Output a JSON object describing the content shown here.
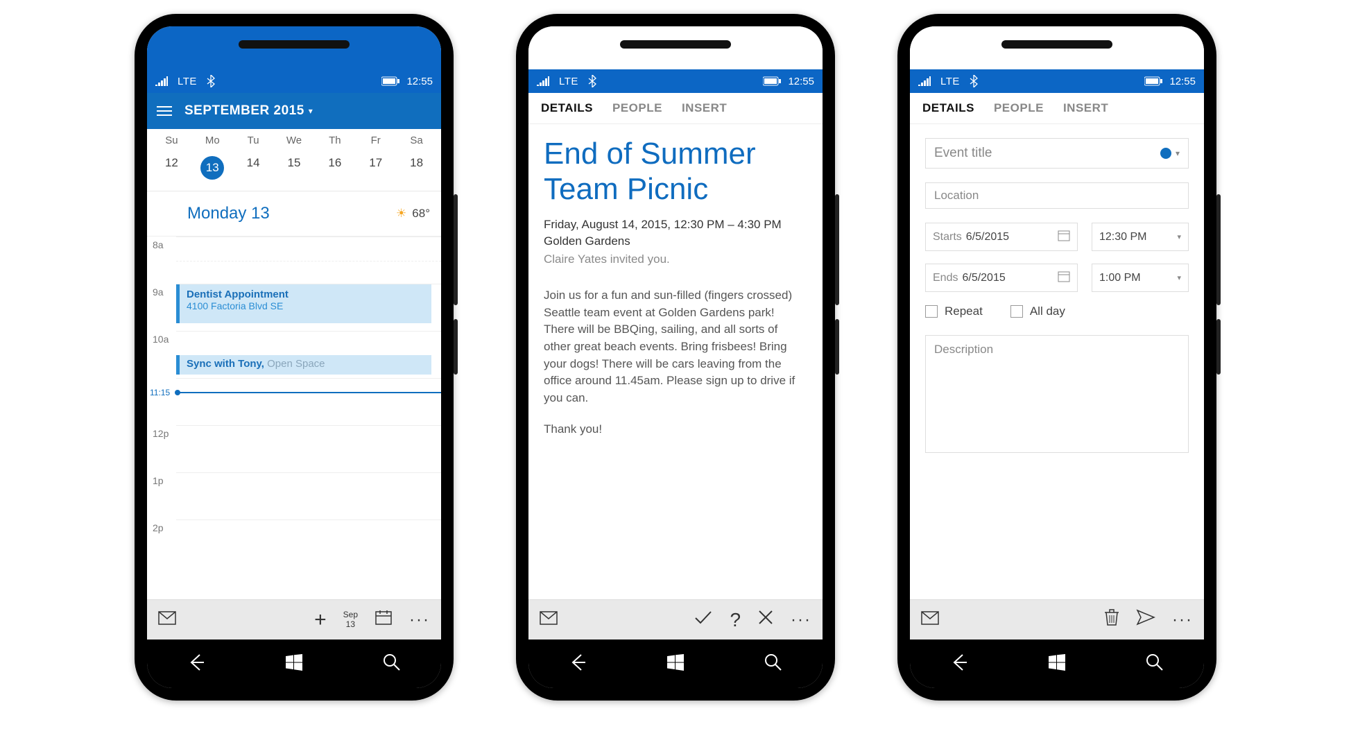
{
  "status": {
    "lte": "LTE",
    "time": "12:55"
  },
  "phone1": {
    "header_title": "SEPTEMBER 2015",
    "weekdays": [
      "Su",
      "Mo",
      "Tu",
      "We",
      "Th",
      "Fr",
      "Sa"
    ],
    "dates": [
      "12",
      "13",
      "14",
      "15",
      "16",
      "17",
      "18"
    ],
    "selected_index": 1,
    "day_title": "Monday 13",
    "temp": "68°",
    "hours": [
      "8a",
      "9a",
      "10a",
      "",
      "12p",
      "1p",
      "2p"
    ],
    "now_label": "11:15",
    "event1_title": "Dentist Appointment",
    "event1_addr": "4100 Factoria Blvd SE",
    "event2_title": "Sync with Tony,",
    "event2_loc": " Open Space",
    "appbar_month": "Sep",
    "appbar_day": "13"
  },
  "tabs": {
    "details": "DETAILS",
    "people": "PEOPLE",
    "insert": "INSERT"
  },
  "phone2": {
    "title": "End of Summer Team Picnic",
    "datetime": "Friday, August 14, 2015, 12:30 PM – 4:30 PM",
    "location": "Golden Gardens",
    "invited": "Claire Yates invited you.",
    "body1": "Join us for a fun and sun-filled (fingers crossed) Seattle team event at Golden Gardens park! There will be BBQing, sailing, and all sorts of other great beach events. Bring frisbees! Bring your dogs! There will be cars leaving from the office around 11.45am. Please sign up to drive if you can.",
    "body2": "Thank you!"
  },
  "phone3": {
    "title_ph": "Event title",
    "location_ph": "Location",
    "starts_lbl": "Starts",
    "starts_date": "6/5/2015",
    "starts_time": "12:30 PM",
    "ends_lbl": "Ends",
    "ends_date": "6/5/2015",
    "ends_time": "1:00 PM",
    "repeat": "Repeat",
    "allday": "All day",
    "desc_ph": "Description"
  }
}
